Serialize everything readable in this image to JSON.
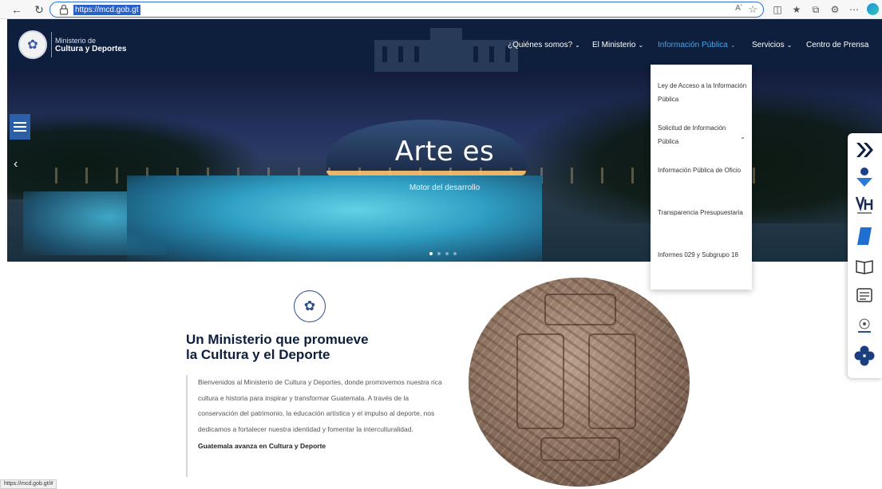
{
  "browser": {
    "url": "https://mcd.gob.gt",
    "read_aloud": "Aʼ",
    "status_url": "https://mcd.gob.gt/#"
  },
  "header": {
    "logo_line1": "Ministerio de",
    "logo_line2": "Cultura y Deportes",
    "nav": [
      {
        "label": "¿Quiénes somos?"
      },
      {
        "label": "El Ministerio"
      },
      {
        "label": "Información Pública"
      },
      {
        "label": "Servicios"
      },
      {
        "label": "Centro de Prensa"
      }
    ],
    "active_nav": "Información Pública",
    "accent_color": "#4da3e6",
    "bg_color": "#0d1f3c"
  },
  "dropdown": {
    "items": [
      {
        "label": "Ley de Acceso a la Información Pública"
      },
      {
        "label": "Solicitud de Información Pública"
      },
      {
        "label": "Información Pública de Oficio"
      },
      {
        "label": "Transparencia Presupuestaria"
      },
      {
        "label": "Informes 029 y Subgrupo 18"
      }
    ]
  },
  "hero": {
    "title": "Arte es",
    "subtitle": "Motor del desarrollo"
  },
  "main": {
    "heading_line1": "Un Ministerio que promueve",
    "heading_line2": "la Cultura y el Deporte",
    "paragraph": "Bienvenidos al Ministerio de Cultura y Deportes, donde promovemos nuestra rica cultura e historia para inspirar y transformar Guatemala. A través de la conservación del patrimonio, la educación artística y el impulso al deporte, nos dedicamos a fortalecer nuestra identidad y fomentar la interculturalidad.",
    "tagline": "Guatemala avanza en Cultura y Deporte"
  },
  "side_panel": {
    "icons": [
      "double-chevron-icon",
      "person-icon",
      "vh-logo-icon",
      "blue-book-icon",
      "open-book-icon",
      "document-icon",
      "seal-icon",
      "clover-icon"
    ]
  }
}
